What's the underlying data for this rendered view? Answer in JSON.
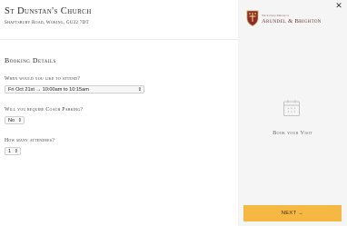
{
  "church": {
    "name": "St Dunstan's Church",
    "address": "Shaftsbury Road, Woking, GU22 7DT"
  },
  "booking": {
    "heading": "Booking Details",
    "attend_label": "When would you like to attend?",
    "attend_value": "Fri Oct 21st → 10:00am to 10:15am",
    "parking_label": "Will you require Coach Parking?",
    "parking_value": "No",
    "attendees_label": "How many attendees?",
    "attendees_value": "1"
  },
  "sidebar": {
    "diocese_prefix": "The Catholic Diocese of",
    "diocese_name": "Arundel & Brighton",
    "close_symbol": "✕",
    "visit_label": "Book your Visit",
    "next_label": "NEXT →"
  },
  "icons": {
    "select_caret": "⇕",
    "close": "close-icon",
    "calendar": "calendar-icon",
    "crest": "diocese-crest-logo"
  },
  "colors": {
    "next_button": "#f5b843",
    "sidebar_background": "#f5f5f5",
    "diocese_text": "#6f2f30"
  }
}
